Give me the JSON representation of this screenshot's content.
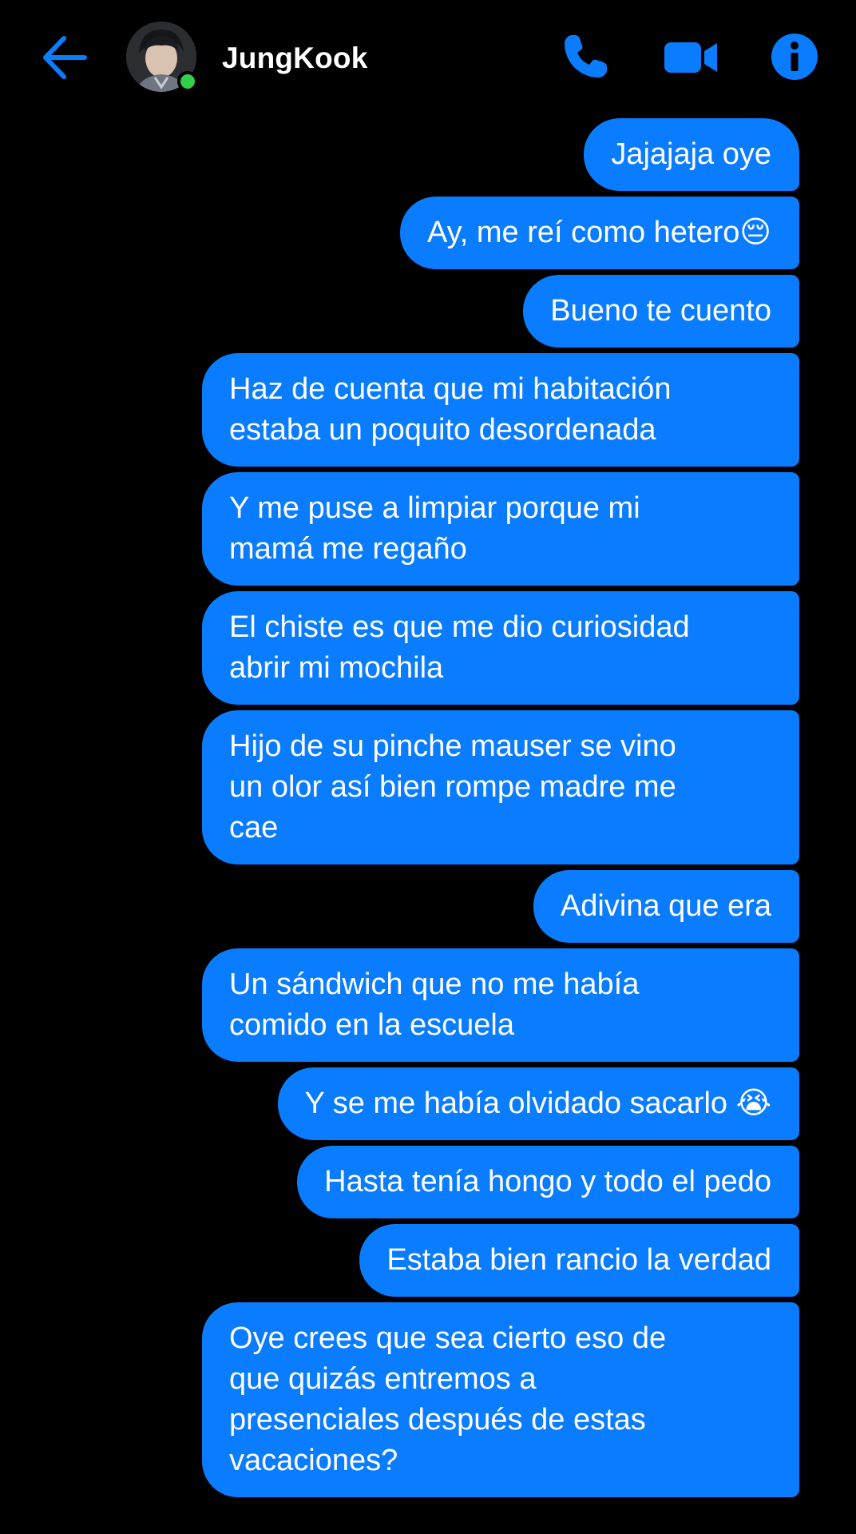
{
  "header": {
    "contact_name": "JungKook",
    "back_icon": "arrow-left-icon",
    "call_icon": "phone-icon",
    "video_icon": "video-camera-icon",
    "info_icon": "info-icon",
    "online_status_color": "#31d04b"
  },
  "colors": {
    "background": "#000000",
    "bubble": "#0a7cff",
    "accent": "#0a7cff",
    "text": "#ffffff"
  },
  "messages": [
    {
      "text": "Jajajaja oye"
    },
    {
      "text": "Ay, me reí como hetero😔"
    },
    {
      "text": "Bueno te cuento"
    },
    {
      "text": "Haz de cuenta que mi habitación\nestaba un poquito desordenada"
    },
    {
      "text": "Y me puse a limpiar porque mi\nmamá me regaño"
    },
    {
      "text": "El chiste es que me dio curiosidad\nabrir mi mochila"
    },
    {
      "text": "Hijo de su pinche mauser se vino\nun olor así bien rompe madre me\ncae"
    },
    {
      "text": "Adivina que era"
    },
    {
      "text": "Un sándwich que no me había\ncomido en la escuela"
    },
    {
      "text": "Y se me había olvidado sacarlo 😭"
    },
    {
      "text": "Hasta tenía hongo y todo el pedo"
    },
    {
      "text": "Estaba bien rancio la verdad"
    },
    {
      "text": "Oye crees que sea cierto eso de\nque quizás entremos a\npresenciales después de estas\nvacaciones?"
    }
  ]
}
